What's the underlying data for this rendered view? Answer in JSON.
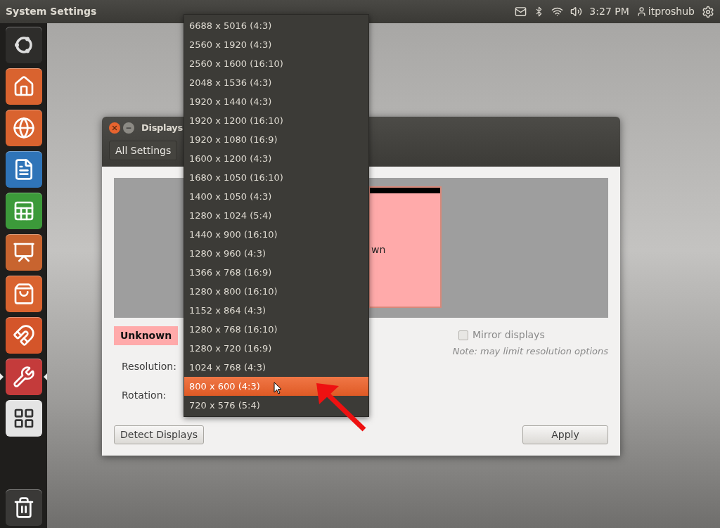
{
  "top_panel": {
    "title": "System Settings",
    "clock": "3:27 PM",
    "user": "itproshub"
  },
  "launcher": {
    "items": [
      {
        "kind": "dash",
        "selected": false
      },
      {
        "kind": "home",
        "selected": false
      },
      {
        "kind": "browser",
        "selected": false
      },
      {
        "kind": "writer",
        "selected": false
      },
      {
        "kind": "calc",
        "selected": false
      },
      {
        "kind": "impress",
        "selected": false
      },
      {
        "kind": "software",
        "selected": false
      },
      {
        "kind": "ubuntu-one",
        "selected": false
      },
      {
        "kind": "settings",
        "selected": true
      },
      {
        "kind": "workspaces",
        "selected": false
      }
    ],
    "trash": {
      "kind": "trash"
    }
  },
  "window": {
    "title": "Displays",
    "toolbar_button": "All Settings",
    "monitor_label": "wn",
    "display_name": "Unknown",
    "resolution_label": "Resolution:",
    "rotation_label": "Rotation:",
    "mirror": {
      "label": "Mirror displays",
      "checked": false
    },
    "note": "Note: may limit resolution options",
    "buttons": {
      "detect": "Detect Displays",
      "apply": "Apply"
    }
  },
  "resolution_menu": {
    "items": [
      {
        "label": "6688 x 5016 (4:3)",
        "selected": false
      },
      {
        "label": "2560 x 1920 (4:3)",
        "selected": false
      },
      {
        "label": "2560 x 1600 (16:10)",
        "selected": false
      },
      {
        "label": "2048 x 1536 (4:3)",
        "selected": false
      },
      {
        "label": "1920 x 1440 (4:3)",
        "selected": false
      },
      {
        "label": "1920 x 1200 (16:10)",
        "selected": false
      },
      {
        "label": "1920 x 1080 (16:9)",
        "selected": false
      },
      {
        "label": "1600 x 1200 (4:3)",
        "selected": false
      },
      {
        "label": "1680 x 1050 (16:10)",
        "selected": false
      },
      {
        "label": "1400 x 1050 (4:3)",
        "selected": false
      },
      {
        "label": "1280 x 1024 (5:4)",
        "selected": false
      },
      {
        "label": "1440 x 900 (16:10)",
        "selected": false
      },
      {
        "label": "1280 x 960 (4:3)",
        "selected": false
      },
      {
        "label": "1366 x 768 (16:9)",
        "selected": false
      },
      {
        "label": "1280 x 800 (16:10)",
        "selected": false
      },
      {
        "label": "1152 x 864 (4:3)",
        "selected": false
      },
      {
        "label": "1280 x 768 (16:10)",
        "selected": false
      },
      {
        "label": "1280 x 720 (16:9)",
        "selected": false
      },
      {
        "label": "1024 x 768 (4:3)",
        "selected": false
      },
      {
        "label": "800 x 600 (4:3)",
        "selected": true
      },
      {
        "label": "720 x 576 (5:4)",
        "selected": false
      }
    ]
  }
}
